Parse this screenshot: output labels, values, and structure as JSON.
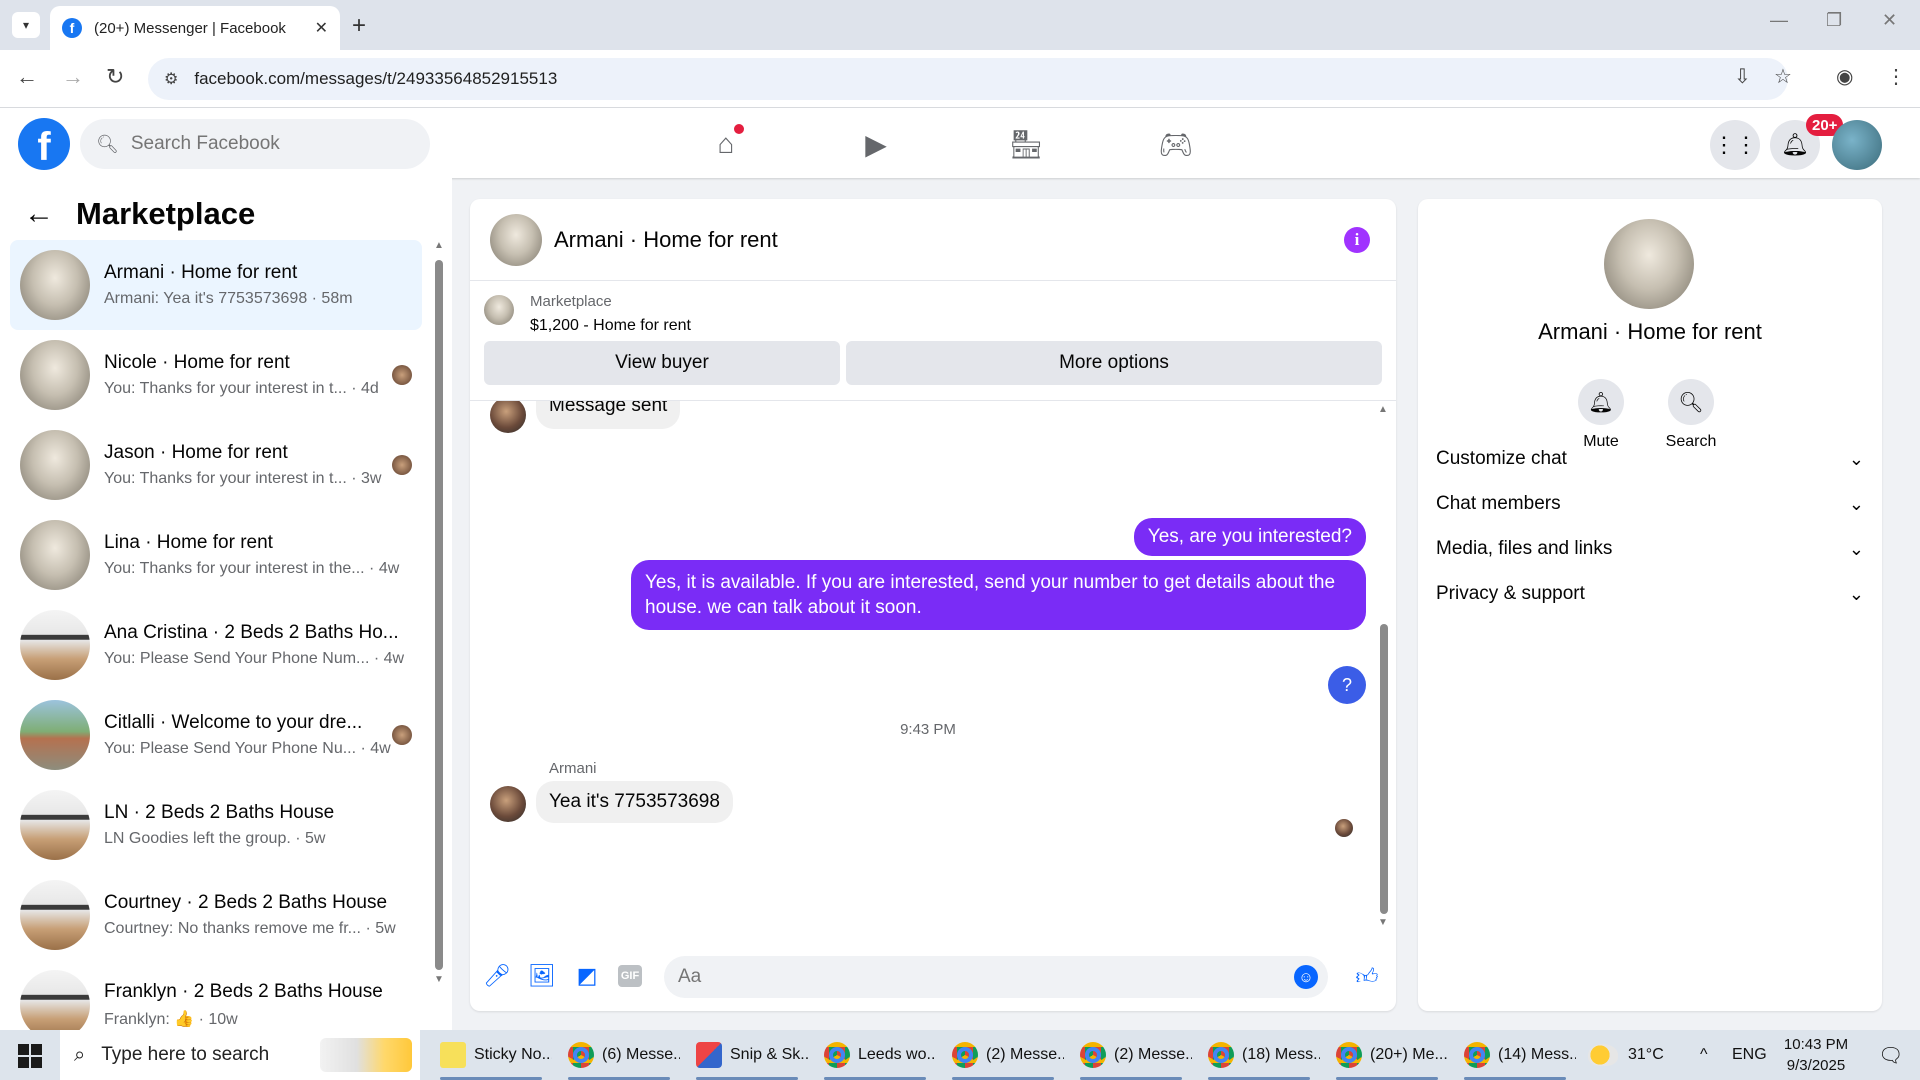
{
  "browser": {
    "tab_title": "(20+) Messenger | Facebook",
    "url": "facebook.com/messages/t/24933564852915513"
  },
  "facebook": {
    "search_placeholder": "Search Facebook",
    "notifications_badge": "20+"
  },
  "sidebar": {
    "title": "Marketplace",
    "conversations": [
      {
        "name": "Armani · Home for rent",
        "preview": "Armani: Yea it's 7753573698 · 58m",
        "avatar": "room",
        "active": true,
        "seen": false
      },
      {
        "name": "Nicole · Home for rent",
        "preview": "You: Thanks for your interest in t... · 4d",
        "avatar": "room",
        "active": false,
        "seen": true
      },
      {
        "name": "Jason · Home for rent",
        "preview": "You: Thanks for your interest in t... · 3w",
        "avatar": "room",
        "active": false,
        "seen": true
      },
      {
        "name": "Lina · Home for rent",
        "preview": "You: Thanks for your interest in the... · 4w",
        "avatar": "room",
        "active": false,
        "seen": false
      },
      {
        "name": "Ana Cristina · 2 Beds 2 Baths Ho...",
        "preview": "You: Please Send Your Phone Num... · 4w",
        "avatar": "house",
        "active": false,
        "seen": false
      },
      {
        "name": "Citlalli · Welcome to your dre...",
        "preview": "You: Please Send Your Phone Nu... · 4w",
        "avatar": "ext",
        "active": false,
        "seen": true
      },
      {
        "name": "LN · 2 Beds 2 Baths House",
        "preview": "LN Goodies left the group. · 5w",
        "avatar": "house",
        "active": false,
        "seen": false
      },
      {
        "name": "Courtney · 2 Beds 2 Baths House",
        "preview": "Courtney: No thanks remove me fr... · 5w",
        "avatar": "house",
        "active": false,
        "seen": false
      },
      {
        "name": "Franklyn · 2 Beds 2 Baths House",
        "preview": "Franklyn: 👍 · 10w",
        "avatar": "house",
        "active": false,
        "seen": false
      }
    ]
  },
  "chat": {
    "title": "Armani · Home for rent",
    "marketplace_label": "Marketplace",
    "listing": "$1,200 - Home for rent",
    "view_buyer": "View buyer",
    "more_options": "More options",
    "msg_top": "Message sent",
    "msg_out_1": "Yes, are you interested?",
    "msg_out_2": "Yes, it is available. If you are interested, send your number to get details about the house. we can talk about it soon.",
    "msg_out_3": "?",
    "timestamp": "9:43 PM",
    "sender": "Armani",
    "msg_in": "Yea it's 7753573698",
    "composer_placeholder": "Aa",
    "gif_label": "GIF"
  },
  "info_panel": {
    "name": "Armani · Home for rent",
    "mute": "Mute",
    "search": "Search",
    "sections": [
      "Customize chat",
      "Chat members",
      "Media, files and links",
      "Privacy & support"
    ]
  },
  "taskbar": {
    "search": "Type here to search",
    "items": [
      {
        "label": "Sticky No...",
        "icon": "sticky"
      },
      {
        "label": "(6) Messe...",
        "icon": "chrome"
      },
      {
        "label": "Snip & Sk...",
        "icon": "snip"
      },
      {
        "label": "Leeds wo...",
        "icon": "chrome"
      },
      {
        "label": "(2) Messe...",
        "icon": "chrome"
      },
      {
        "label": "(2) Messe...",
        "icon": "chrome"
      },
      {
        "label": "(18) Mess...",
        "icon": "chrome"
      },
      {
        "label": "(20+) Me...",
        "icon": "chrome"
      },
      {
        "label": "(14) Mess...",
        "icon": "chrome"
      }
    ],
    "weather": "31°C",
    "lang": "ENG",
    "time": "10:43 PM",
    "date": "9/3/2025"
  }
}
